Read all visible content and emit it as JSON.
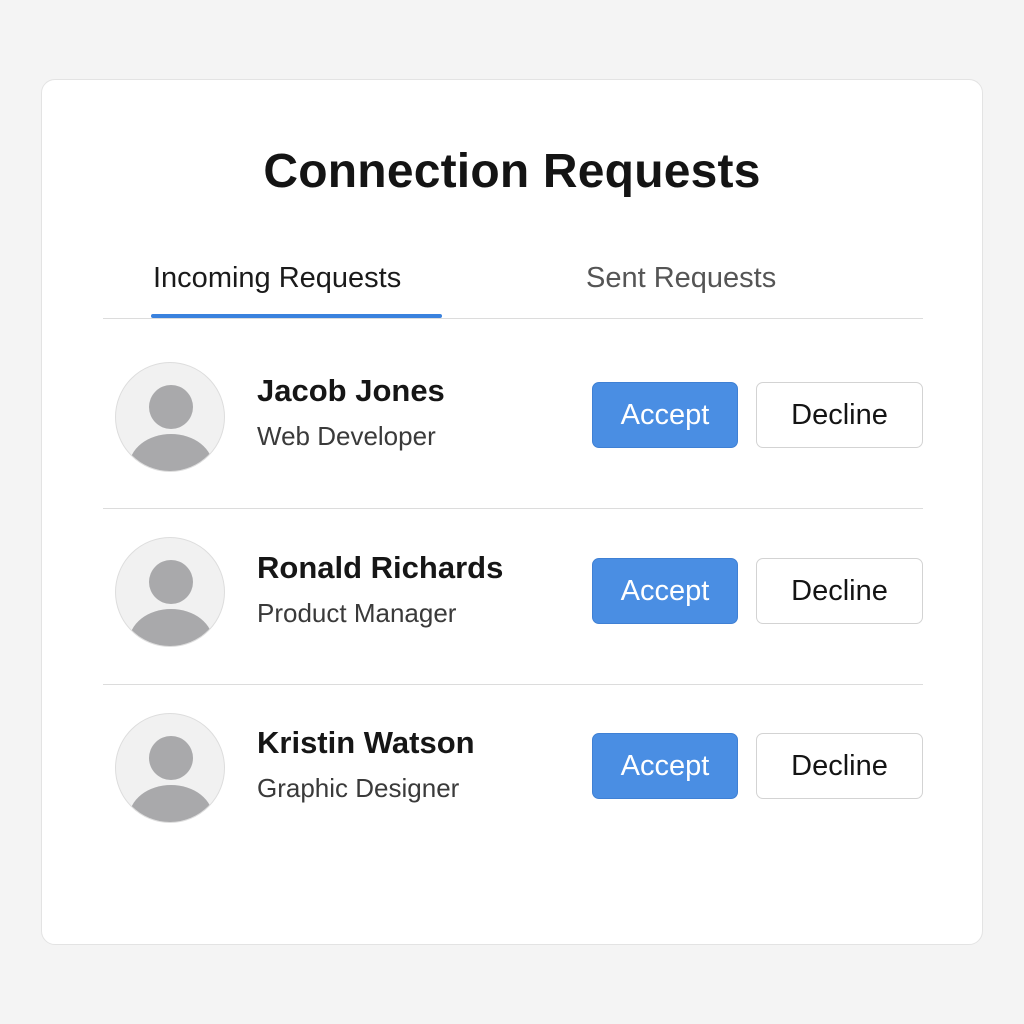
{
  "title": "Connection Requests",
  "tabs": {
    "incoming": "Incoming Requests",
    "sent": "Sent Requests",
    "active": "incoming"
  },
  "requests": [
    {
      "name": "Jacob Jones",
      "role": "Web Developer",
      "accept_label": "Accept",
      "decline_label": "Decline"
    },
    {
      "name": "Ronald Richards",
      "role": "Product Manager",
      "accept_label": "Accept",
      "decline_label": "Decline"
    },
    {
      "name": "Kristin Watson",
      "role": "Graphic Designer",
      "accept_label": "Accept",
      "decline_label": "Decline"
    }
  ],
  "colors": {
    "accent": "#4a8ee3",
    "tab_underline": "#3a82de",
    "avatar_silhouette": "#a9a9ab",
    "background": "#f4f4f4"
  },
  "icons": {
    "avatar": "user-silhouette-icon"
  }
}
